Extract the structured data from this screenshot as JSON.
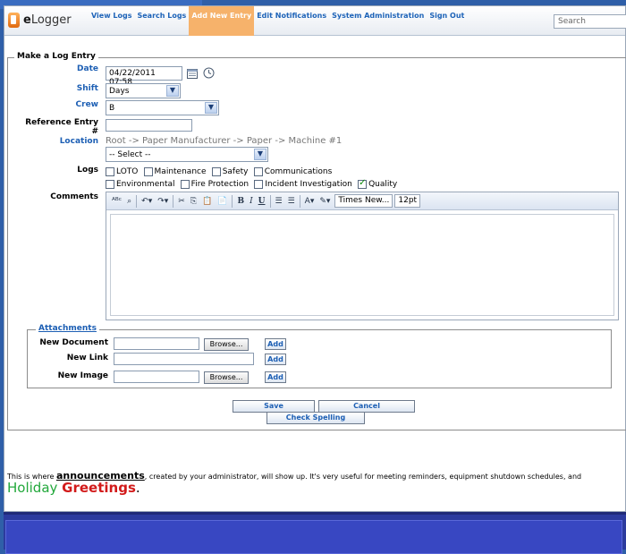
{
  "app": {
    "logo_prefix": "e",
    "logo_rest": "Logger"
  },
  "nav": {
    "items": [
      "View Logs",
      "Search Logs",
      "Add New Entry",
      "Edit Notifications",
      "System Administration",
      "Sign Out"
    ],
    "active_index": 2
  },
  "search": {
    "placeholder": "Search"
  },
  "form": {
    "legend": "Make a Log Entry",
    "date": {
      "label": "Date",
      "value": "04/22/2011 07:58"
    },
    "shift": {
      "label": "Shift",
      "value": "Days"
    },
    "crew": {
      "label": "Crew",
      "value": "B"
    },
    "reference": {
      "label": "Reference Entry",
      "label2": "#",
      "value": ""
    },
    "location": {
      "label": "Location",
      "path": "Root -> Paper Manufacturer -> Paper -> Machine #1",
      "select_value": "-- Select --"
    },
    "logs": {
      "label": "Logs",
      "options": [
        {
          "label": "LOTO",
          "checked": false
        },
        {
          "label": "Maintenance",
          "checked": false
        },
        {
          "label": "Safety",
          "checked": false
        },
        {
          "label": "Communications",
          "checked": false
        },
        {
          "label": "Environmental",
          "checked": false
        },
        {
          "label": "Fire Protection",
          "checked": false
        },
        {
          "label": "Incident Investigation",
          "checked": false
        },
        {
          "label": "Quality",
          "checked": true
        }
      ]
    },
    "comments": {
      "label": "Comments",
      "font_name": "Times New...",
      "font_size": "12pt"
    }
  },
  "attachments": {
    "legend": "Attachments",
    "new_document": {
      "label": "New Document",
      "browse": "Browse...",
      "add": "Add"
    },
    "new_link": {
      "label": "New Link",
      "add": "Add"
    },
    "new_image": {
      "label": "New Image",
      "browse": "Browse...",
      "add": "Add"
    }
  },
  "actions": {
    "save": "Save",
    "cancel": "Cancel",
    "check_spelling": "Check Spelling"
  },
  "announcement": {
    "pre": "This is where ",
    "keyword": "announcements",
    "post": ", created by your administrator, will show up. It's very useful for meeting reminders, equipment shutdown schedules, and",
    "holiday": "Holiday ",
    "greetings": "Greetings",
    "period": "."
  },
  "colors": {
    "accent": "#1d5fb4",
    "active_tab": "#f6b26b",
    "background": "#2f5fa8",
    "footer": "#3847c2"
  }
}
